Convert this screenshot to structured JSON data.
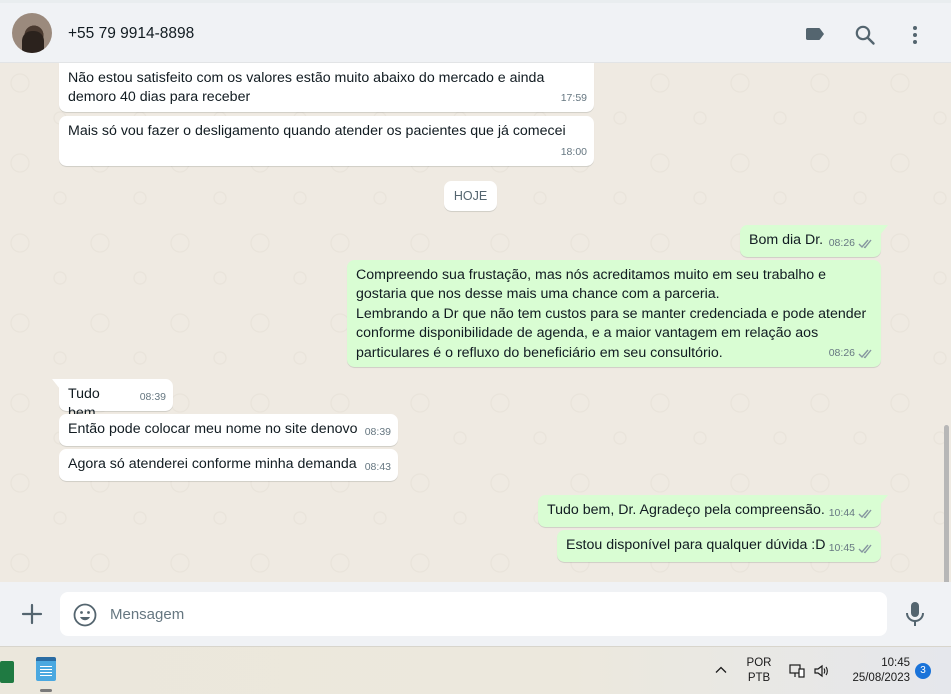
{
  "header": {
    "contact_name": "+55 79 9914-8898",
    "icons": [
      "label-icon",
      "search-icon",
      "menu-dots-icon"
    ]
  },
  "chat": {
    "date_chip": "HOJE",
    "messages": [
      {
        "dir": "in",
        "text": "Não estou satisfeito com os valores estão muito abaixo do mercado e ainda\ndemoro 40 dias para receber",
        "time": "17:59"
      },
      {
        "dir": "in",
        "text": "Mais só vou fazer o desligamento quando atender os pacientes que já comecei",
        "time": "18:00"
      },
      {
        "dir": "out",
        "text": "Bom dia Dr.",
        "time": "08:26",
        "status": "read"
      },
      {
        "dir": "out",
        "text": "Compreendo sua frustação, mas nós acreditamos muito em seu trabalho e\ngostaria que nos desse mais uma chance com a parceria.\nLembrando a Dr que não tem custos para se manter credenciada e pode atender\nconforme disponibilidade de agenda, e a maior vantagem em relação aos\nparticulares é o refluxo do beneficiário em seu consultório.",
        "time": "08:26",
        "status": "read"
      },
      {
        "dir": "in",
        "text": "Tudo bem",
        "time": "08:39"
      },
      {
        "dir": "in",
        "text": "Então pode colocar meu nome no site denovo",
        "time": "08:39"
      },
      {
        "dir": "in",
        "text": "Agora só atenderei conforme minha demanda",
        "time": "08:43"
      },
      {
        "dir": "out",
        "text": "Tudo bem, Dr. Agradeço pela compreensão.",
        "time": "10:44",
        "status": "read"
      },
      {
        "dir": "out",
        "text": "Estou disponível para qualquer dúvida :D",
        "time": "10:45",
        "status": "read"
      }
    ]
  },
  "composer": {
    "placeholder": "Mensagem"
  },
  "taskbar": {
    "lang_line1": "POR",
    "lang_line2": "PTB",
    "time": "10:45",
    "date": "25/08/2023",
    "notification_count": "3"
  },
  "colors": {
    "incoming_bubble": "#ffffff",
    "outgoing_bubble": "#d9fdd3",
    "chat_bg": "#efeae2",
    "read_ticks": "#8696a0"
  }
}
